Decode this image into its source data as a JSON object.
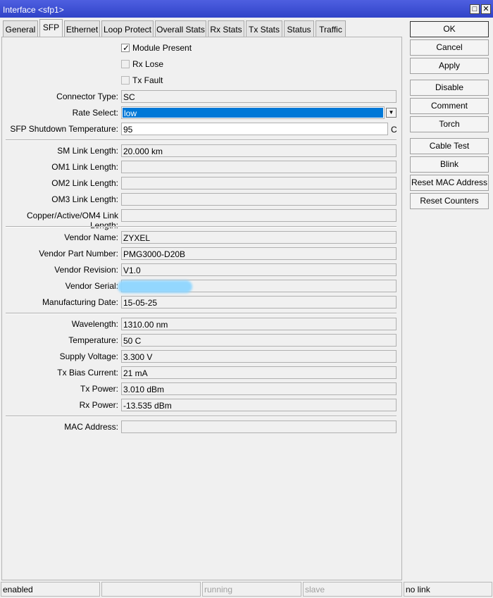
{
  "window": {
    "title": "Interface <sfp1>",
    "restore_glyph": "□",
    "close_glyph": "✕"
  },
  "tabs": [
    "General",
    "SFP",
    "Ethernet",
    "Loop Protect",
    "Overall Stats",
    "Rx Stats",
    "Tx Stats",
    "Status",
    "Traffic"
  ],
  "active_tab": "SFP",
  "checkboxes": {
    "module_present": {
      "label": "Module Present",
      "checked": true,
      "mark": "✓"
    },
    "rx_lose": {
      "label": "Rx Lose",
      "checked": false
    },
    "tx_fault": {
      "label": "Tx Fault",
      "checked": false
    }
  },
  "fields": {
    "connector_type": {
      "label": "Connector Type:",
      "value": "SC"
    },
    "rate_select": {
      "label": "Rate Select:",
      "value": "low",
      "dropdown_glyph": "▼"
    },
    "sfp_shutdown_temp": {
      "label": "SFP Shutdown Temperature:",
      "value": "95",
      "unit": "C"
    },
    "sm_link_length": {
      "label": "SM Link Length:",
      "value": "20.000 km"
    },
    "om1_link_length": {
      "label": "OM1 Link Length:",
      "value": ""
    },
    "om2_link_length": {
      "label": "OM2 Link Length:",
      "value": ""
    },
    "om3_link_length": {
      "label": "OM3 Link Length:",
      "value": ""
    },
    "copper_link_length": {
      "label": "Copper/Active/OM4 Link Length:",
      "value": ""
    },
    "vendor_name": {
      "label": "Vendor Name:",
      "value": "ZYXEL"
    },
    "vendor_part_number": {
      "label": "Vendor Part Number:",
      "value": "PMG3000-D20B"
    },
    "vendor_revision": {
      "label": "Vendor Revision:",
      "value": "V1.0"
    },
    "vendor_serial": {
      "label": "Vendor Serial:",
      "value": ""
    },
    "manufacturing_date": {
      "label": "Manufacturing Date:",
      "value": "15-05-25"
    },
    "wavelength": {
      "label": "Wavelength:",
      "value": "1310.00 nm"
    },
    "temperature": {
      "label": "Temperature:",
      "value": "50 C"
    },
    "supply_voltage": {
      "label": "Supply Voltage:",
      "value": "3.300 V"
    },
    "tx_bias_current": {
      "label": "Tx Bias Current:",
      "value": "21 mA"
    },
    "tx_power": {
      "label": "Tx Power:",
      "value": "3.010 dBm"
    },
    "rx_power": {
      "label": "Rx Power:",
      "value": "-13.535 dBm"
    },
    "mac_address": {
      "label": "MAC Address:",
      "value": ""
    }
  },
  "buttons": {
    "ok": "OK",
    "cancel": "Cancel",
    "apply": "Apply",
    "disable": "Disable",
    "comment": "Comment",
    "torch": "Torch",
    "cable_test": "Cable Test",
    "blink": "Blink",
    "reset_mac": "Reset MAC Address",
    "reset_counters": "Reset Counters"
  },
  "status": {
    "state": "enabled",
    "empty": "",
    "running": "running",
    "slave": "slave",
    "link": "no link"
  },
  "colors": {
    "title_bar": "#3c4fd0",
    "selection": "#0078d7",
    "redaction": "#8fd6ff"
  }
}
